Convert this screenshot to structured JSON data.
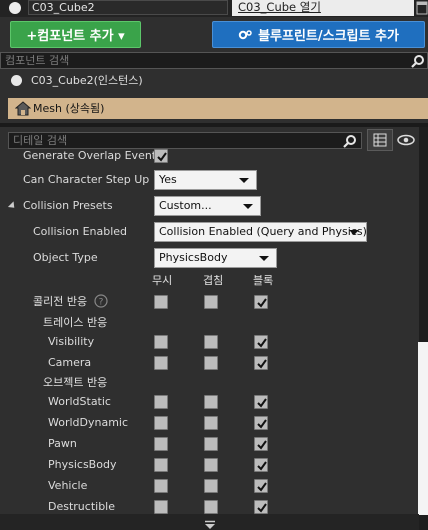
{
  "top": {
    "actor_name": "C03_Cube2",
    "open_blueprint_label": "C03_Cube 열기"
  },
  "toolbar": {
    "add_component_label": "+컴포넌트 추가 ▾",
    "add_blueprint_label": "블루프린트/스크립트 추가"
  },
  "components": {
    "search_placeholder": "컴포넌트 검색",
    "root_label": "C03_Cube2(인스턴스)",
    "mesh_label": "Mesh (상속됨)"
  },
  "details": {
    "search_placeholder": "디테일 검색",
    "generate_overlap_label": "Generate Overlap Events",
    "generate_overlap_checked": true,
    "step_up_label": "Can Character Step Up On",
    "step_up_value": "Yes",
    "collision_presets_label": "Collision Presets",
    "collision_presets_value": "Custom...",
    "collision_enabled_label": "Collision Enabled",
    "collision_enabled_value": "Collision Enabled (Query and Physics)",
    "object_type_label": "Object Type",
    "object_type_value": "PhysicsBody",
    "columns": [
      "무시",
      "겹침",
      "블록"
    ],
    "collision_response_label": "콜리전 반응",
    "trace_header": "트레이스 반응",
    "object_header": "오브젝트 반응",
    "rows": [
      {
        "label": "Visibility",
        "response": "block"
      },
      {
        "label": "Camera",
        "response": "block"
      },
      {
        "label": "WorldStatic",
        "response": "block"
      },
      {
        "label": "WorldDynamic",
        "response": "block"
      },
      {
        "label": "Pawn",
        "response": "block"
      },
      {
        "label": "PhysicsBody",
        "response": "block"
      },
      {
        "label": "Vehicle",
        "response": "block"
      },
      {
        "label": "Destructible",
        "response": "block"
      }
    ]
  },
  "colors": {
    "add_component": "#3aa34a",
    "add_blueprint": "#1f6fbf",
    "selected_row": "#d2b48c"
  }
}
